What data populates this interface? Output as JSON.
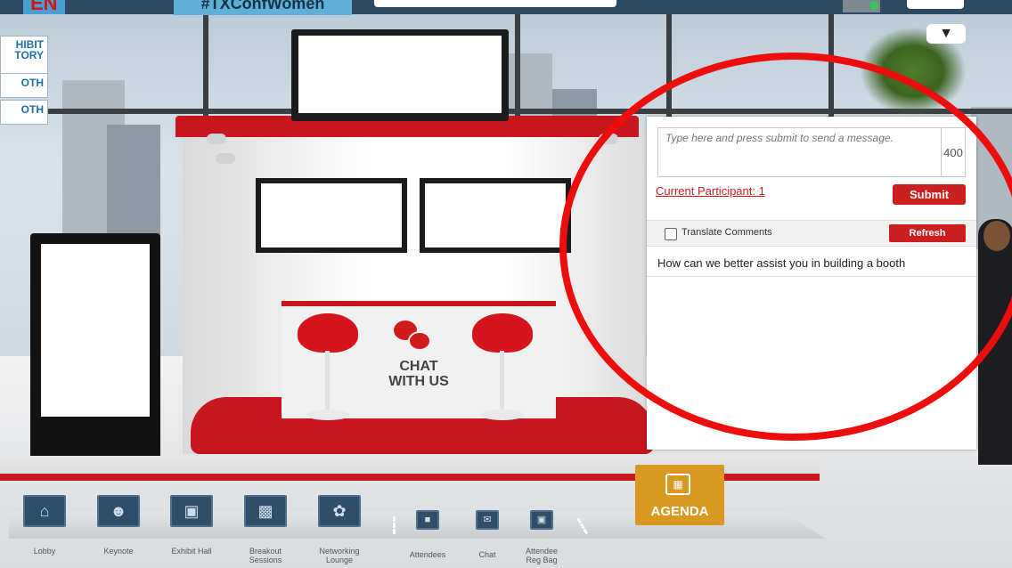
{
  "header": {
    "logo_fragment": "EN",
    "hashtag": "#TXConfWomen"
  },
  "left_nav": {
    "items": [
      "HIBIT\nTORY",
      "OTH",
      "OTH"
    ]
  },
  "booth": {
    "chat_label_line1": "CHAT",
    "chat_label_line2": "WITH US"
  },
  "chat_panel": {
    "message_placeholder": "Type here and press submit to send a message.",
    "char_counter": "400",
    "participants_link": "Current Participant: 1",
    "submit_label": "Submit",
    "translate_label": "Translate Comments",
    "refresh_label": "Refresh",
    "comments": [
      "How can we better assist you in building a booth"
    ]
  },
  "bottom_nav": {
    "items": [
      {
        "label": "Lobby"
      },
      {
        "label": "Keynote"
      },
      {
        "label": "Exhibit Hall"
      },
      {
        "label": "Breakout\nSessions"
      },
      {
        "label": "Networking\nLounge"
      },
      {
        "label": "Attendees"
      },
      {
        "label": "Chat"
      },
      {
        "label": "Attendee\nReg Bag"
      }
    ]
  },
  "agenda": {
    "label": "AGENDA"
  },
  "colors": {
    "accent_red": "#cc1f1f",
    "annotation_red": "#ee0d0d",
    "nav_blue": "#2f4e6a",
    "agenda_gold": "#d9981f"
  },
  "icons": {
    "trophy": "trophy-icon",
    "chat": "chat-bubbles-icon",
    "agenda": "calendar-icon"
  }
}
